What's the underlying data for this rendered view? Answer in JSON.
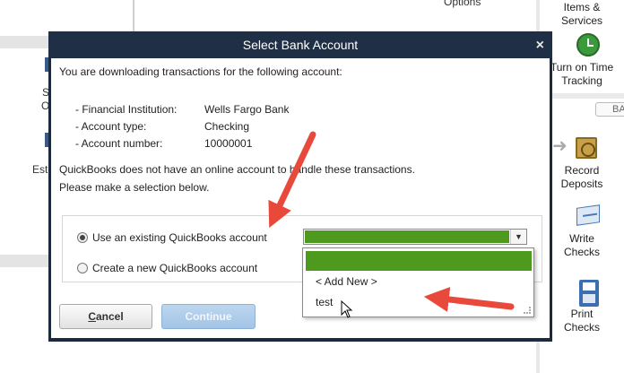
{
  "background": {
    "left_fragments": [
      "S",
      "O",
      "Est"
    ],
    "top_fragment": "Options"
  },
  "right_panel": {
    "items": [
      {
        "label_line1": "Items &",
        "label_line2": "Services",
        "icon": "items-icon"
      },
      {
        "label_line1": "Turn on Time",
        "label_line2": "Tracking",
        "icon": "clock-icon"
      },
      {
        "label_line1": "Record",
        "label_line2": "Deposits",
        "icon": "safe-icon"
      },
      {
        "label_line1": "Write",
        "label_line2": "Checks",
        "icon": "check-icon"
      },
      {
        "label_line1": "Print",
        "label_line2": "Checks",
        "icon": "printer-icon"
      }
    ],
    "tab_label": "BA"
  },
  "dialog": {
    "title": "Select Bank Account",
    "close_label": "×",
    "intro": "You are downloading transactions for the following account:",
    "details": [
      {
        "label": "- Financial Institution:",
        "value": "Wells Fargo Bank"
      },
      {
        "label": "- Account type:",
        "value": "Checking"
      },
      {
        "label": "- Account number:",
        "value": "10000001"
      }
    ],
    "message_line1": "QuickBooks does not have an online account to handle these transactions.",
    "message_line2": "Please make a selection below.",
    "options": {
      "existing_label": "Use an existing QuickBooks account",
      "new_label": "Create a new QuickBooks account",
      "selected": "existing"
    },
    "account_combo": {
      "highlight_color": "#4e9a1e",
      "arrow": "▼"
    },
    "dropdown_items": [
      "< Add New >",
      "test"
    ],
    "buttons": {
      "cancel_prefix": "C",
      "cancel_rest": "ancel",
      "continue": "Continue"
    }
  },
  "colors": {
    "title_bar": "#1f2f45",
    "annotation_arrow": "#e8493a",
    "selection_green": "#4e9a1e"
  }
}
